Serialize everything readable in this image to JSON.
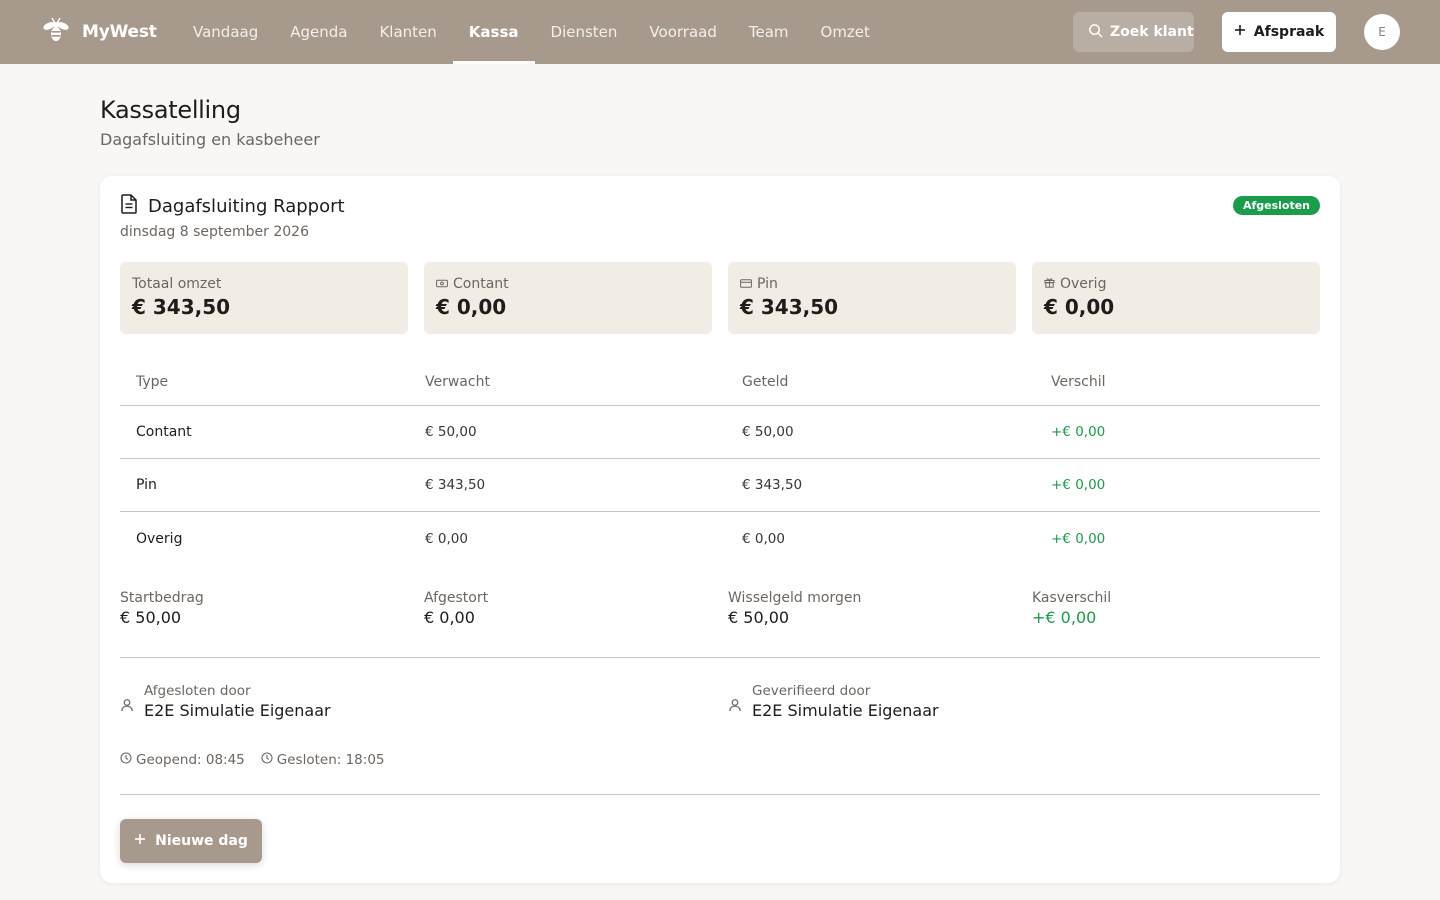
{
  "app": {
    "name": "MyWest"
  },
  "nav": {
    "items": [
      {
        "label": "Vandaag"
      },
      {
        "label": "Agenda"
      },
      {
        "label": "Klanten"
      },
      {
        "label": "Kassa",
        "active": true
      },
      {
        "label": "Diensten"
      },
      {
        "label": "Voorraad"
      },
      {
        "label": "Team"
      },
      {
        "label": "Omzet"
      }
    ],
    "search_label": "Zoek klant",
    "add_label": "Afspraak",
    "avatar_initial": "E"
  },
  "page": {
    "title": "Kassatelling",
    "subtitle": "Dagafsluiting en kasbeheer"
  },
  "report": {
    "title": "Dagafsluiting Rapport",
    "date": "dinsdag 8 september 2026",
    "status": "Afgesloten",
    "stats": [
      {
        "label": "Totaal omzet",
        "value": "€ 343,50",
        "icon": "none"
      },
      {
        "label": "Contant",
        "value": "€ 0,00",
        "icon": "banknote-icon"
      },
      {
        "label": "Pin",
        "value": "€ 343,50",
        "icon": "credit-card-icon"
      },
      {
        "label": "Overig",
        "value": "€ 0,00",
        "icon": "gift-icon"
      }
    ],
    "table": {
      "headers": [
        "Type",
        "Verwacht",
        "Geteld",
        "Verschil"
      ],
      "rows": [
        {
          "type": "Contant",
          "expected": "€ 50,00",
          "counted": "€ 50,00",
          "difference": "+€ 0,00"
        },
        {
          "type": "Pin",
          "expected": "€ 343,50",
          "counted": "€ 343,50",
          "difference": "+€ 0,00"
        },
        {
          "type": "Overig",
          "expected": "€ 0,00",
          "counted": "€ 0,00",
          "difference": "+€ 0,00"
        }
      ]
    },
    "summary": [
      {
        "label": "Startbedrag",
        "value": "€ 50,00"
      },
      {
        "label": "Afgestort",
        "value": "€ 0,00"
      },
      {
        "label": "Wisselgeld morgen",
        "value": "€ 50,00"
      },
      {
        "label": "Kasverschil",
        "value": "+€ 0,00"
      }
    ],
    "closed_by": {
      "label": "Afgesloten door",
      "name": "E2E Simulatie Eigenaar"
    },
    "verified_by": {
      "label": "Geverifieerd door",
      "name": "E2E Simulatie Eigenaar"
    },
    "opened": "Geopend: 08:45",
    "closed": "Gesloten: 18:05",
    "new_day_label": "Nieuwe dag"
  },
  "colors": {
    "topbar": "#a79a8d",
    "accent_green": "#1a9d4a",
    "stat_bg": "#f1ece4",
    "page_bg": "#f8f7f5"
  }
}
